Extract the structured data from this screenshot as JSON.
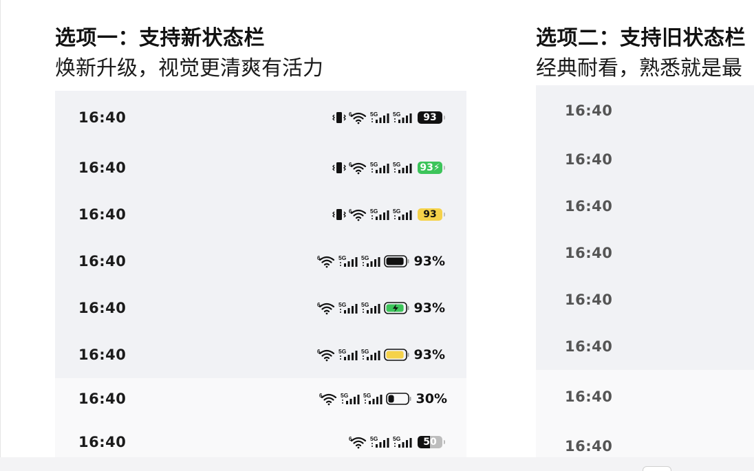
{
  "option1": {
    "title": "选项一：支持新状态栏",
    "subtitle": "焕新升级，视觉更清爽有活力",
    "rows": [
      {
        "time": "16:40",
        "vibrate": true,
        "battery_style": "pill",
        "battery_text": "93",
        "battery_color": "#111111",
        "battery_text_color": "#ffffff"
      },
      {
        "time": "16:40",
        "vibrate": true,
        "battery_style": "pill",
        "battery_text": "93⚡",
        "battery_color": "#3cc45a",
        "battery_text_color": "#ffffff"
      },
      {
        "time": "16:40",
        "vibrate": true,
        "battery_style": "pill",
        "battery_text": "93",
        "battery_color": "#f5d24a",
        "battery_text_color": "#111111"
      },
      {
        "time": "16:40",
        "vibrate": false,
        "battery_style": "outline",
        "battery_fill": 0.93,
        "battery_color": "#111111",
        "battery_text": "93%"
      },
      {
        "time": "16:40",
        "vibrate": false,
        "battery_style": "outline-charging",
        "battery_fill": 0.93,
        "battery_color": "#3cc45a",
        "battery_text": "93%"
      },
      {
        "time": "16:40",
        "vibrate": false,
        "battery_style": "outline",
        "battery_fill": 0.93,
        "battery_color": "#f5d24a",
        "battery_text": "93%"
      },
      {
        "time": "16:40",
        "vibrate": false,
        "battery_style": "outline",
        "battery_fill": 0.3,
        "battery_color": "#111111",
        "battery_text": "30%"
      },
      {
        "time": "16:40",
        "vibrate": false,
        "battery_style": "pill-half",
        "battery_text": "50",
        "battery_color": "#111111",
        "battery_text_color": "#ffffff"
      }
    ]
  },
  "option2": {
    "title": "选项二：支持旧状态栏",
    "subtitle": "经典耐看，熟悉就是最",
    "rows": [
      {
        "time": "16:40"
      },
      {
        "time": "16:40"
      },
      {
        "time": "16:40"
      },
      {
        "time": "16:40"
      },
      {
        "time": "16:40"
      },
      {
        "time": "16:40"
      },
      {
        "time": "16:40"
      },
      {
        "time": "16:40"
      }
    ]
  },
  "icons": {
    "vibrate": "vibrate-icon",
    "wifi": "wifi-6-icon",
    "signal": "signal-5g-icon",
    "battery": "battery-icon"
  },
  "labels": {
    "wifi_gen": "6",
    "net_gen": "5G"
  }
}
